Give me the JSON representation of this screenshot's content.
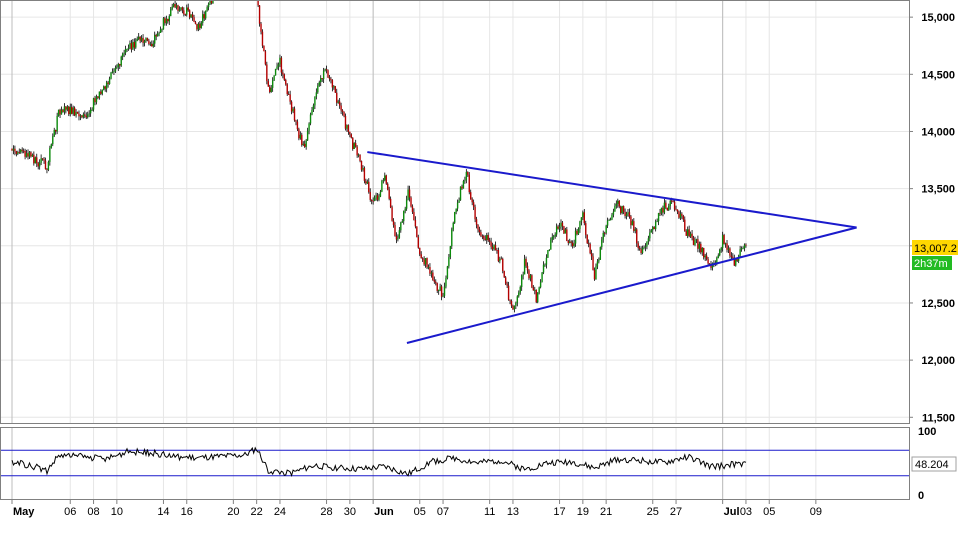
{
  "chart_data": {
    "type": "candlestick",
    "main": {
      "y_ticks": [
        {
          "value": 15000,
          "label": "15,000"
        },
        {
          "value": 14500,
          "label": "14,500"
        },
        {
          "value": 14000,
          "label": "14,000"
        },
        {
          "value": 13500,
          "label": "13,500"
        },
        {
          "value": 13000,
          "label": "13,000"
        },
        {
          "value": 12500,
          "label": "12,500"
        },
        {
          "value": 12000,
          "label": "12,000"
        },
        {
          "value": 11500,
          "label": "11,500"
        }
      ],
      "ylim": [
        11450,
        15150
      ],
      "current_value_label": "13,007.2",
      "countdown_label": "2h37m",
      "trendlines": [
        {
          "name": "upper",
          "from": {
            "day": 30.5,
            "value": 13820
          },
          "to": {
            "day": 72.5,
            "value": 13160
          }
        },
        {
          "name": "lower",
          "from": {
            "day": 33.9,
            "value": 12150
          },
          "to": {
            "day": 72.5,
            "value": 13160
          }
        }
      ],
      "path_anchors": [
        [
          0,
          13850
        ],
        [
          1,
          13820
        ],
        [
          2,
          13750
        ],
        [
          3,
          13700
        ],
        [
          4,
          14150
        ],
        [
          5,
          14200
        ],
        [
          6,
          14120
        ],
        [
          7,
          14250
        ],
        [
          8,
          14400
        ],
        [
          9,
          14550
        ],
        [
          10,
          14720
        ],
        [
          11,
          14800
        ],
        [
          12,
          14750
        ],
        [
          13,
          14950
        ],
        [
          14,
          15100
        ],
        [
          15,
          15050
        ],
        [
          16,
          14900
        ],
        [
          17,
          15150
        ],
        [
          18,
          15200
        ],
        [
          19,
          15250
        ],
        [
          20,
          15300
        ],
        [
          21,
          15200
        ],
        [
          22,
          14350
        ],
        [
          23,
          14600
        ],
        [
          24,
          14200
        ],
        [
          25,
          13850
        ],
        [
          26,
          14300
        ],
        [
          27,
          14550
        ],
        [
          28,
          14250
        ],
        [
          29,
          13950
        ],
        [
          30,
          13700
        ],
        [
          31,
          13350
        ],
        [
          32,
          13600
        ],
        [
          33,
          13050
        ],
        [
          34,
          13450
        ],
        [
          35,
          12950
        ],
        [
          36,
          12750
        ],
        [
          37,
          12550
        ],
        [
          38,
          13300
        ],
        [
          39,
          13650
        ],
        [
          40,
          13100
        ],
        [
          41,
          13050
        ],
        [
          42,
          12850
        ],
        [
          43,
          12400
        ],
        [
          44,
          12850
        ],
        [
          45,
          12550
        ],
        [
          46,
          12950
        ],
        [
          47,
          13200
        ],
        [
          48,
          13000
        ],
        [
          49,
          13250
        ],
        [
          50,
          12750
        ],
        [
          51,
          13200
        ],
        [
          52,
          13350
        ],
        [
          53,
          13250
        ],
        [
          54,
          12950
        ],
        [
          55,
          13150
        ],
        [
          56,
          13350
        ],
        [
          57,
          13350
        ],
        [
          58,
          13100
        ],
        [
          59,
          13000
        ],
        [
          60,
          12800
        ],
        [
          61,
          13050
        ],
        [
          62,
          12850
        ],
        [
          63,
          13000
        ]
      ],
      "price_range_days": [
        0,
        63
      ],
      "last_close": 13007.2
    },
    "indicator": {
      "y_ticks": [
        {
          "value": 100,
          "label": "100"
        },
        {
          "value": 0,
          "label": "0"
        }
      ],
      "ylim": [
        0,
        100
      ],
      "reference_lines": [
        70,
        30
      ],
      "current_value_label": "48.204",
      "anchors": [
        [
          0,
          52
        ],
        [
          2,
          44
        ],
        [
          3,
          38
        ],
        [
          4,
          62
        ],
        [
          6,
          60
        ],
        [
          8,
          56
        ],
        [
          10,
          68
        ],
        [
          12,
          66
        ],
        [
          14,
          60
        ],
        [
          16,
          58
        ],
        [
          18,
          60
        ],
        [
          20,
          62
        ],
        [
          21,
          72
        ],
        [
          22,
          38
        ],
        [
          24,
          34
        ],
        [
          26,
          46
        ],
        [
          28,
          42
        ],
        [
          30,
          40
        ],
        [
          32,
          44
        ],
        [
          34,
          32
        ],
        [
          36,
          52
        ],
        [
          38,
          58
        ],
        [
          40,
          50
        ],
        [
          42,
          54
        ],
        [
          44,
          40
        ],
        [
          46,
          50
        ],
        [
          48,
          52
        ],
        [
          50,
          42
        ],
        [
          52,
          56
        ],
        [
          54,
          54
        ],
        [
          56,
          50
        ],
        [
          58,
          60
        ],
        [
          60,
          44
        ],
        [
          62,
          48
        ],
        [
          63,
          48
        ]
      ]
    },
    "x_axis": {
      "ticks": [
        {
          "day": 0,
          "label": "May",
          "bold": true
        },
        {
          "day": 5,
          "label": "06",
          "bold": false
        },
        {
          "day": 7,
          "label": "08",
          "bold": false
        },
        {
          "day": 9,
          "label": "10",
          "bold": false
        },
        {
          "day": 13,
          "label": "14",
          "bold": false
        },
        {
          "day": 15,
          "label": "16",
          "bold": false
        },
        {
          "day": 19,
          "label": "20",
          "bold": false
        },
        {
          "day": 21,
          "label": "22",
          "bold": false
        },
        {
          "day": 23,
          "label": "24",
          "bold": false
        },
        {
          "day": 27,
          "label": "28",
          "bold": false
        },
        {
          "day": 29,
          "label": "30",
          "bold": false
        },
        {
          "day": 31,
          "label": "Jun",
          "bold": true
        },
        {
          "day": 35,
          "label": "05",
          "bold": false
        },
        {
          "day": 37,
          "label": "07",
          "bold": false
        },
        {
          "day": 41,
          "label": "11",
          "bold": false
        },
        {
          "day": 43,
          "label": "13",
          "bold": false
        },
        {
          "day": 47,
          "label": "17",
          "bold": false
        },
        {
          "day": 49,
          "label": "19",
          "bold": false
        },
        {
          "day": 51,
          "label": "21",
          "bold": false
        },
        {
          "day": 55,
          "label": "25",
          "bold": false
        },
        {
          "day": 57,
          "label": "27",
          "bold": false
        },
        {
          "day": 61,
          "label": "Jul",
          "bold": true
        },
        {
          "day": 63,
          "label": "03",
          "bold": false
        },
        {
          "day": 65,
          "label": "05",
          "bold": false
        },
        {
          "day": 69,
          "label": "09",
          "bold": false
        }
      ],
      "separators": [
        0,
        31,
        61
      ]
    },
    "colors": {
      "up": "#0b8a0b",
      "down": "#b40000",
      "trendline": "#1a1acc",
      "current_bg": "#ffd700",
      "countdown_bg": "#22bb22",
      "grid": "#e6e6e6",
      "indicator_line": "#000000"
    }
  }
}
